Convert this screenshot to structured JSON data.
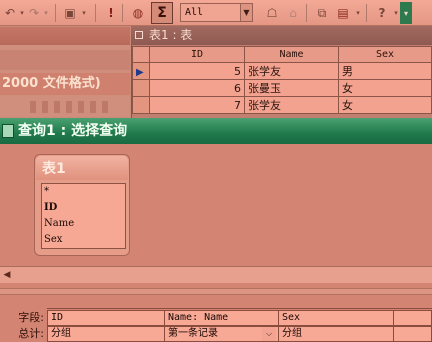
{
  "toolbar": {
    "top_values": "All",
    "sigma": "Σ"
  },
  "db_window": {
    "format_text": "2000 文件格式)"
  },
  "table_window": {
    "title": "表1 : 表",
    "columns": [
      "ID",
      "Name",
      "Sex"
    ],
    "rows": [
      {
        "id": "5",
        "name": "张学友",
        "sex": "男",
        "selected": true
      },
      {
        "id": "6",
        "name": "张曼玉",
        "sex": "女",
        "selected": false
      },
      {
        "id": "7",
        "name": "张学友",
        "sex": "女",
        "selected": false
      }
    ]
  },
  "query_window": {
    "title": "查询1 : 选择查询",
    "field_list": {
      "title": "表1",
      "items": [
        "*",
        "ID",
        "Name",
        "Sex"
      ]
    },
    "design_grid": {
      "field_label": "字段:",
      "total_label": "总计:",
      "fields": [
        "ID",
        "Name: Name",
        "Sex"
      ],
      "totals": [
        "分组",
        "第一条记录",
        "分组"
      ]
    }
  }
}
